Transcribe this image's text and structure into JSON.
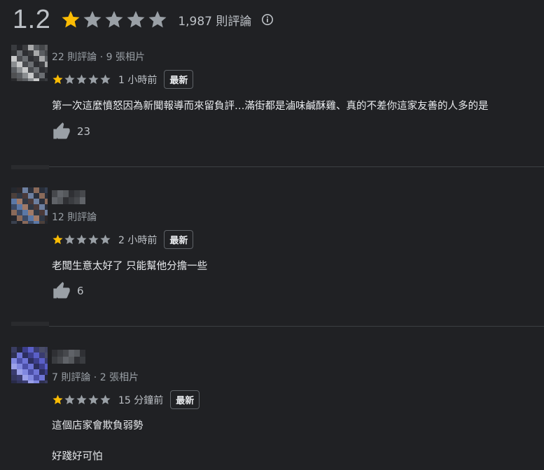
{
  "summary": {
    "rating": "1.2",
    "stars_filled": 1,
    "stars_total": 5,
    "review_count": "1,987 則評論",
    "info_icon": "info-icon"
  },
  "colors": {
    "background": "#202124",
    "star_filled": "#fbbc04",
    "star_empty": "#9aa0a6",
    "text_primary": "#e8eaed",
    "text_secondary": "#9aa0a6",
    "divider": "#3c4043"
  },
  "reviews": [
    {
      "meta": "22 則評論 · 9 張相片",
      "rating": 1,
      "time": "1 小時前",
      "badge": "最新",
      "text_lines": [
        "第一次這麼憤怒因為新聞報導而來留負評…滿街都是滷味鹹酥雞、真的不差你這家友善的人多的是"
      ],
      "likes": "23"
    },
    {
      "meta": "12 則評論",
      "rating": 1,
      "time": "2 小時前",
      "badge": "最新",
      "text_lines": [
        "老闆生意太好了 只能幫他分擔一些"
      ],
      "likes": "6"
    },
    {
      "meta": "7 則評論 · 2 張相片",
      "rating": 1,
      "time": "15 分鐘前",
      "badge": "最新",
      "text_lines": [
        "這個店家會欺負弱勢",
        "好踐好可怕"
      ],
      "likes": ""
    }
  ]
}
